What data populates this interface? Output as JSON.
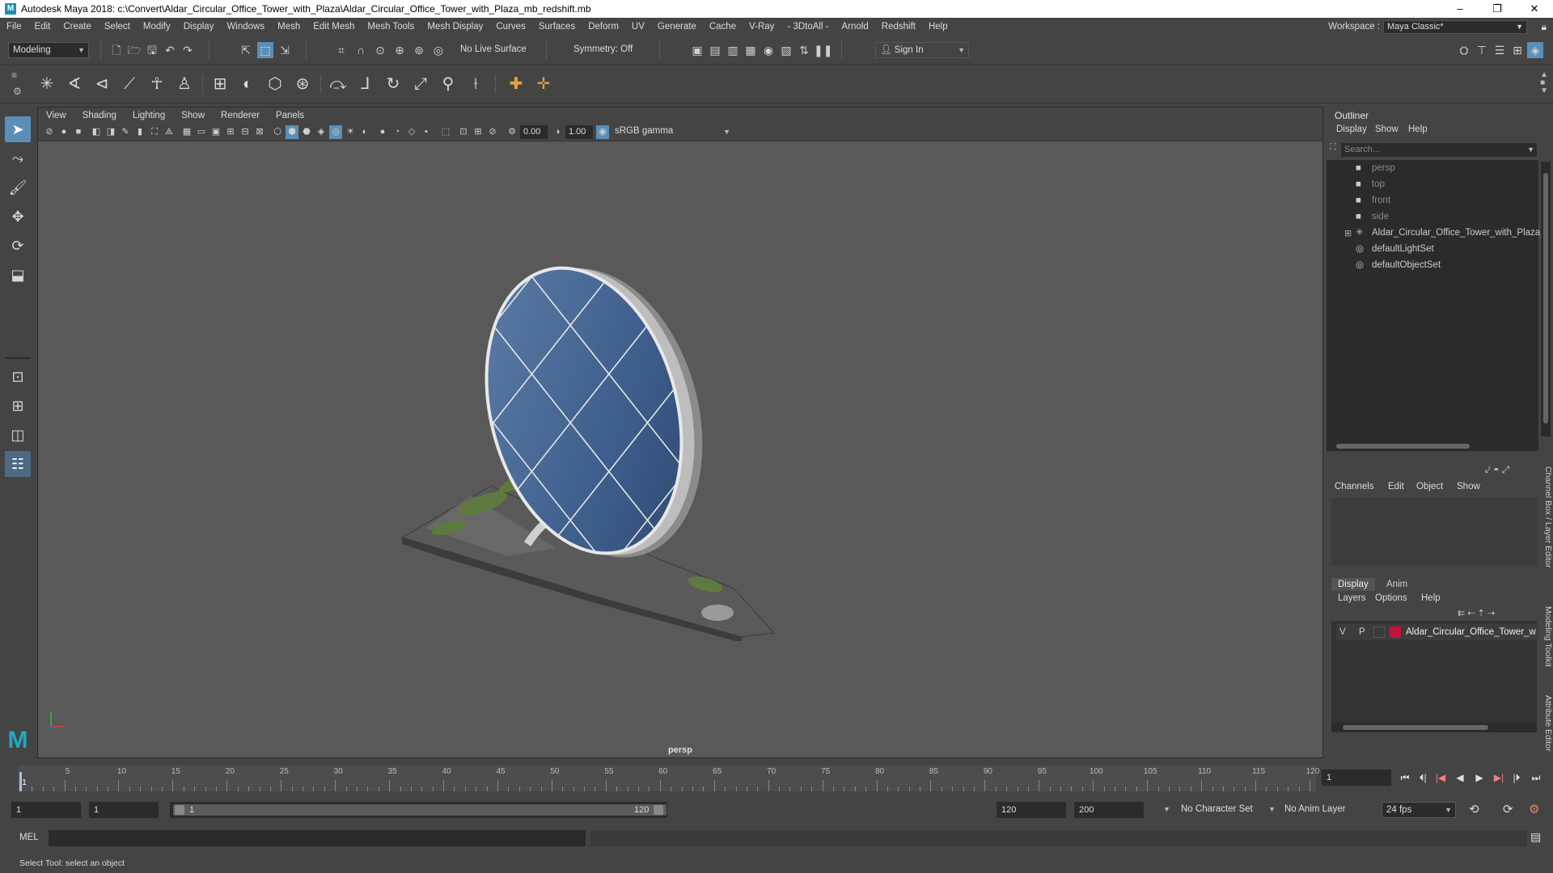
{
  "window": {
    "title": "Autodesk Maya 2018: c:\\Convert\\Aldar_Circular_Office_Tower_with_Plaza\\Aldar_Circular_Office_Tower_with_Plaza_mb_redshift.mb",
    "logo": "M",
    "controls": [
      "–",
      "❐",
      "✕"
    ]
  },
  "menubar": {
    "items": [
      "File",
      "Edit",
      "Create",
      "Select",
      "Modify",
      "Display",
      "Windows",
      "Mesh",
      "Edit Mesh",
      "Mesh Tools",
      "Mesh Display",
      "Curves",
      "Surfaces",
      "Deform",
      "UV",
      "Generate",
      "Cache",
      "V-Ray",
      "- 3DtoAll -",
      "Arnold",
      "Redshift",
      "Help"
    ],
    "workspace_label": "Workspace :",
    "workspace_value": "Maya Classic*"
  },
  "statusline": {
    "mode": "Modeling",
    "live_surface": "No Live Surface",
    "symmetry": "Symmetry: Off",
    "sign_in": "Sign In"
  },
  "viewport": {
    "menus": [
      "View",
      "Shading",
      "Lighting",
      "Show",
      "Renderer",
      "Panels"
    ],
    "exposure": "0.00",
    "gamma": "1.00",
    "color_space": "sRGB gamma",
    "camera": "persp"
  },
  "outliner": {
    "title": "Outliner",
    "menus": [
      "Display",
      "Show",
      "Help"
    ],
    "search_placeholder": "Search...",
    "items": [
      {
        "label": "persp",
        "icon": "camera-icon",
        "dim": true
      },
      {
        "label": "top",
        "icon": "camera-icon",
        "dim": true
      },
      {
        "label": "front",
        "icon": "camera-icon",
        "dim": true
      },
      {
        "label": "side",
        "icon": "camera-icon",
        "dim": true
      },
      {
        "label": "Aldar_Circular_Office_Tower_with_Plaza_",
        "icon": "group-icon",
        "dim": false
      },
      {
        "label": "defaultLightSet",
        "icon": "set-icon",
        "dim": false
      },
      {
        "label": "defaultObjectSet",
        "icon": "set-icon",
        "dim": false
      }
    ]
  },
  "channelbox": {
    "menus": [
      "Channels",
      "Edit",
      "Object",
      "Show"
    ],
    "vertical_label": "Channel Box / Layer Editor"
  },
  "layers": {
    "tabs": [
      "Display",
      "Anim"
    ],
    "menus": [
      "Layers",
      "Options",
      "Help"
    ],
    "row": {
      "v": "V",
      "p": "P",
      "name": "Aldar_Circular_Office_Tower_w",
      "color": "#c0143c"
    }
  },
  "side_tabs": [
    "Modeling Toolkit",
    "Attribute Editor"
  ],
  "timeline": {
    "ticks": [
      1,
      5,
      10,
      15,
      20,
      25,
      30,
      35,
      40,
      45,
      50,
      55,
      60,
      65,
      70,
      75,
      80,
      85,
      90,
      95,
      100,
      105,
      110,
      115,
      120
    ],
    "current_frame": "1"
  },
  "range": {
    "start": "1",
    "playback_start": "1",
    "slider_start": "1",
    "slider_end": "120",
    "playback_end": "120",
    "end": "200",
    "character_set": "No Character Set",
    "anim_layer": "No Anim Layer",
    "fps": "24 fps"
  },
  "cmdline": {
    "label": "MEL"
  },
  "helpline": {
    "text": "Select Tool: select an object"
  },
  "colors": {
    "accent": "#5a8fb8",
    "layer": "#c0143c"
  }
}
